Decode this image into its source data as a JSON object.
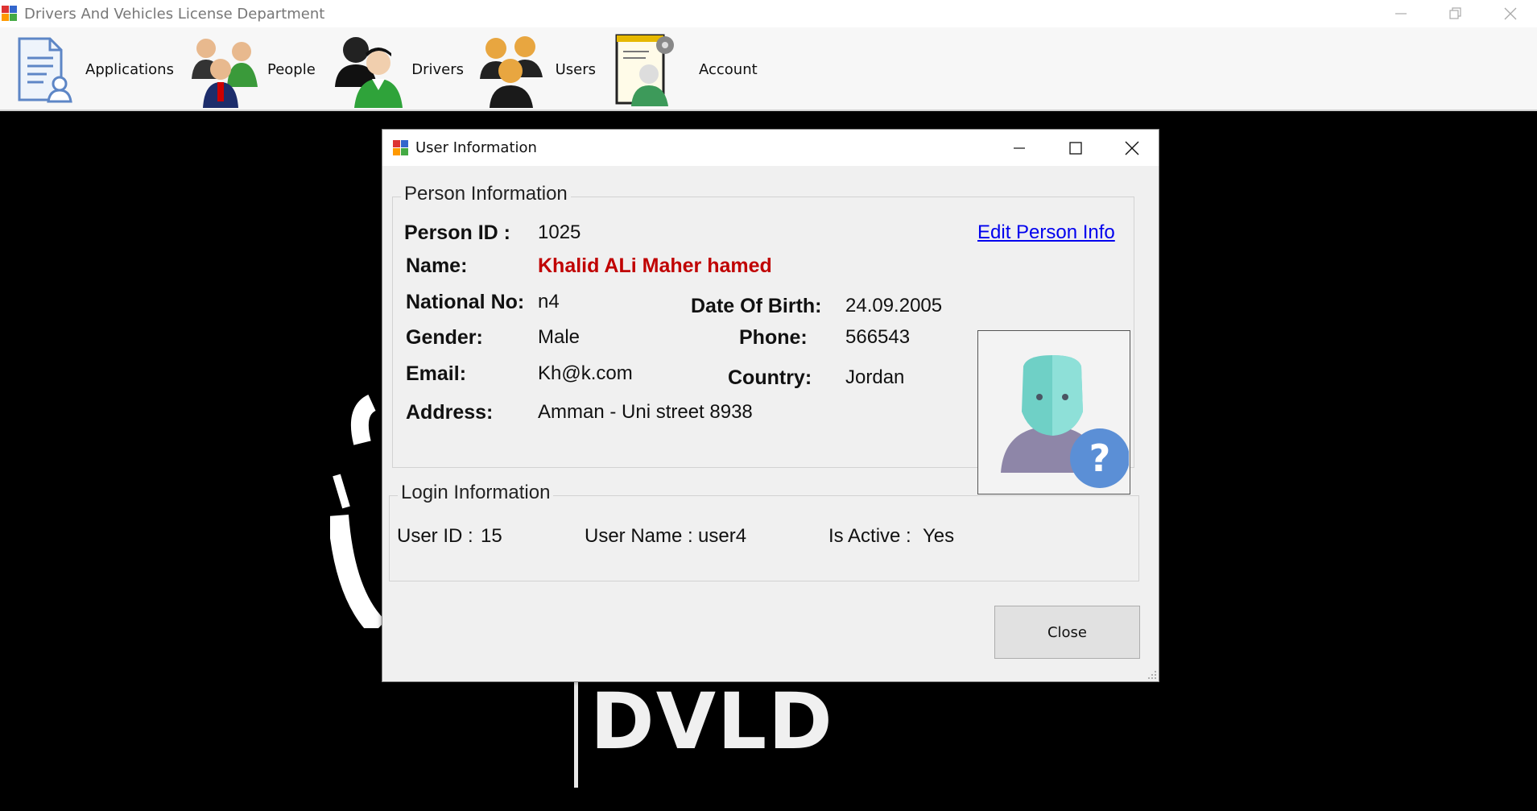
{
  "app": {
    "title": "Drivers And Vehicles License Department",
    "logo_text": "DVLD"
  },
  "window_controls": [
    "minimize",
    "restore",
    "close"
  ],
  "menu": {
    "items": [
      {
        "label": "Applications",
        "icon": "applications-icon"
      },
      {
        "label": "People",
        "icon": "people-icon"
      },
      {
        "label": "Drivers",
        "icon": "drivers-icon"
      },
      {
        "label": "Users",
        "icon": "users-icon"
      },
      {
        "label": "Account",
        "icon": "account-icon"
      }
    ]
  },
  "dialog": {
    "title": "User Information",
    "person_group": {
      "legend": "Person Information",
      "edit_link": "Edit Person Info",
      "labels": {
        "person_id": "Person ID :",
        "name": "Name:",
        "national_no": "National No:",
        "gender": "Gender:",
        "email": "Email:",
        "address": "Address:",
        "date_of_birth": "Date Of Birth:",
        "phone": "Phone:",
        "country": "Country:"
      },
      "values": {
        "person_id": "1025",
        "name": "Khalid ALi Maher hamed",
        "national_no": "n4",
        "gender": "Male",
        "email": "Kh@k.com",
        "address": "Amman - Uni street 8938",
        "date_of_birth": "24.09.2005",
        "phone": "566543",
        "country": "Jordan"
      }
    },
    "login_group": {
      "legend": "Login Information",
      "user_id_label": "User ID :",
      "user_id": "15",
      "user_name_label": "User Name :",
      "user_name": "user4",
      "is_active_label": "Is Active :",
      "is_active": "Yes"
    },
    "close_label": "Close"
  },
  "colors": {
    "name_red": "#c00000",
    "link_blue": "#0000ee",
    "dialog_bg": "#f0f0f0",
    "desktop_bg": "#000000"
  }
}
